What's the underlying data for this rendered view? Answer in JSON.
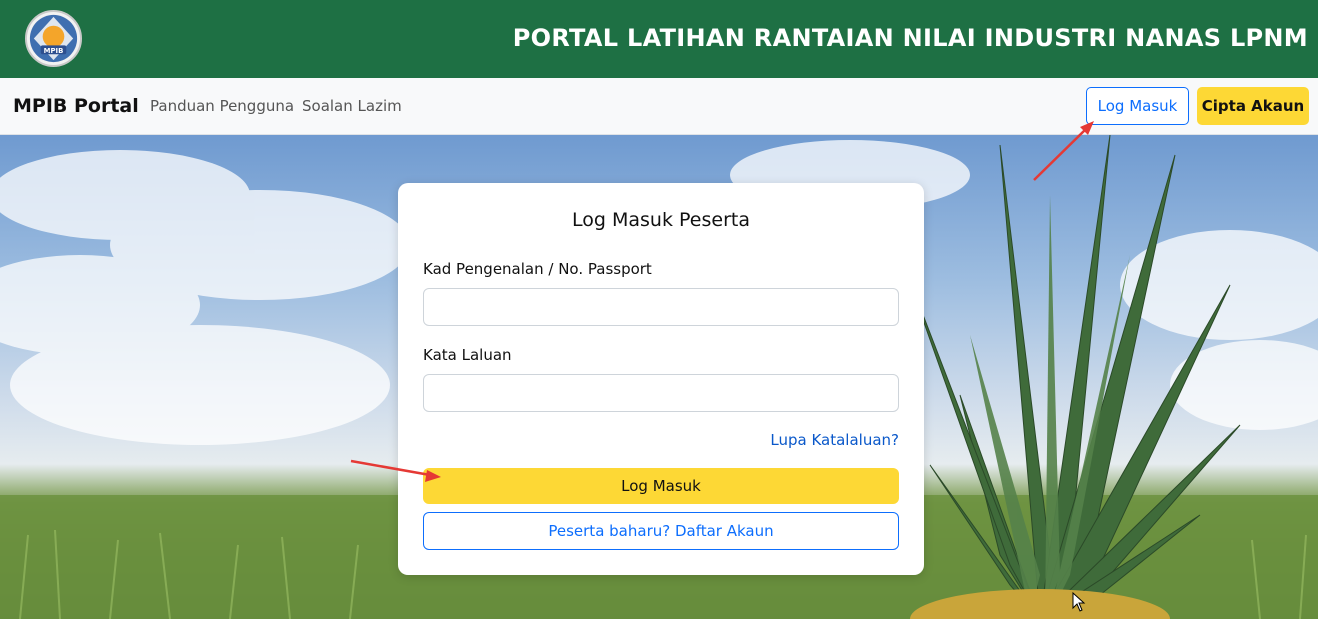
{
  "banner": {
    "title": "PORTAL LATIHAN RANTAIAN NILAI INDUSTRI NANAS LPNM",
    "logo_text": "MPIB",
    "background": "#1e7044"
  },
  "navbar": {
    "brand": "MPIB Portal",
    "links": [
      "Panduan Pengguna",
      "Soalan Lazim"
    ],
    "login_button": "Log Masuk",
    "register_button": "Cipta Akaun"
  },
  "login_card": {
    "title": "Log Masuk Peserta",
    "ic_label": "Kad Pengenalan / No. Passport",
    "ic_value": "",
    "password_label": "Kata Laluan",
    "password_value": "",
    "forgot_link": "Lupa Katalaluan?",
    "submit_button": "Log Masuk",
    "register_button": "Peserta baharu? Daftar Akaun"
  },
  "colors": {
    "accent_yellow": "#fdd835",
    "primary_blue": "#0d6efd",
    "annotation_arrow": "#e53935"
  },
  "icons": [
    "mpib-logo",
    "mouse-cursor-icon",
    "annotation-arrow"
  ]
}
